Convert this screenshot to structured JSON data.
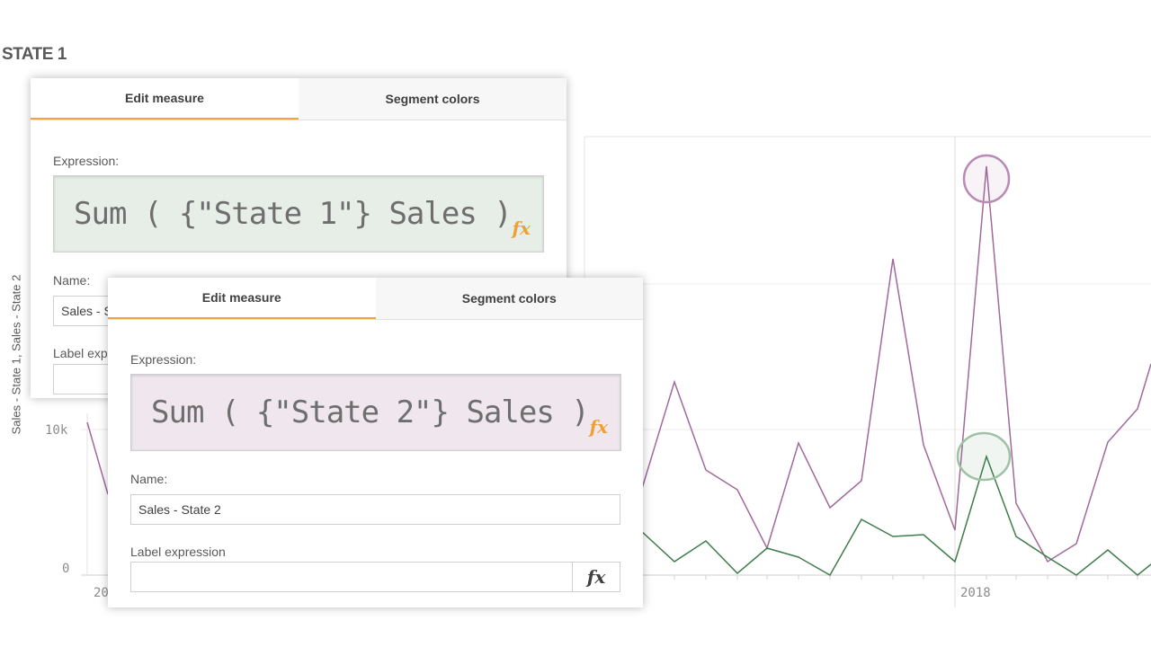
{
  "sheet": {
    "title": "STATE 1"
  },
  "chart_data": {
    "type": "line",
    "ylabel": "Sales - State 1, Sales - State 2",
    "y_ticks": [
      "0",
      "10k"
    ],
    "x_ticks_visible": [
      "20",
      "2018"
    ],
    "series": [
      {
        "name": "Sales - State 1",
        "color": "#a06a9b",
        "points": [
          [
            712,
            550
          ],
          [
            750,
            425
          ],
          [
            785,
            523
          ],
          [
            820,
            545
          ],
          [
            853,
            610
          ],
          [
            888,
            493
          ],
          [
            923,
            565
          ],
          [
            958,
            535
          ],
          [
            993,
            288
          ],
          [
            1027,
            495
          ],
          [
            1062,
            590
          ],
          [
            1097,
            185
          ],
          [
            1130,
            560
          ],
          [
            1165,
            625
          ],
          [
            1197,
            605
          ],
          [
            1232,
            492
          ],
          [
            1265,
            455
          ],
          [
            1280,
            405
          ]
        ]
      },
      {
        "name": "Sales - State 2",
        "color": "#3f7d4b",
        "points": [
          [
            712,
            590
          ],
          [
            750,
            625
          ],
          [
            785,
            602
          ],
          [
            820,
            638
          ],
          [
            853,
            610
          ],
          [
            888,
            620
          ],
          [
            923,
            640
          ],
          [
            958,
            578
          ],
          [
            993,
            597
          ],
          [
            1027,
            595
          ],
          [
            1062,
            625
          ],
          [
            1097,
            508
          ],
          [
            1130,
            597
          ],
          [
            1165,
            620
          ],
          [
            1197,
            640
          ],
          [
            1232,
            612
          ],
          [
            1265,
            640
          ],
          [
            1280,
            628
          ]
        ],
        "left_fragment": [
          [
            97,
            470
          ],
          [
            120,
            550
          ]
        ]
      }
    ],
    "highlight": "2018 peak markers (circled)"
  },
  "panel_state1": {
    "tabs": [
      "Edit measure",
      "Segment colors"
    ],
    "active_tab": 0,
    "expression_label": "Expression:",
    "expression": "Sum ( {\"State 1\"} Sales )",
    "expression_bg": "#e7ede7",
    "name_label": "Name:",
    "name_value": "Sales - S",
    "label_expression_label": "Label exp"
  },
  "panel_state2": {
    "tabs": [
      "Edit measure",
      "Segment colors"
    ],
    "active_tab": 0,
    "expression_label": "Expression:",
    "expression": "Sum ( {\"State 2\"} Sales )",
    "expression_bg": "#efe6ee",
    "name_label": "Name:",
    "name_value": "Sales - State 2",
    "label_expression_label": "Label expression",
    "label_expression_value": ""
  },
  "icons": {
    "fx": "fx"
  },
  "colors": {
    "accent": "#f8a13f",
    "state1_line": "#a06a9b",
    "state2_line": "#3f7d4b"
  }
}
